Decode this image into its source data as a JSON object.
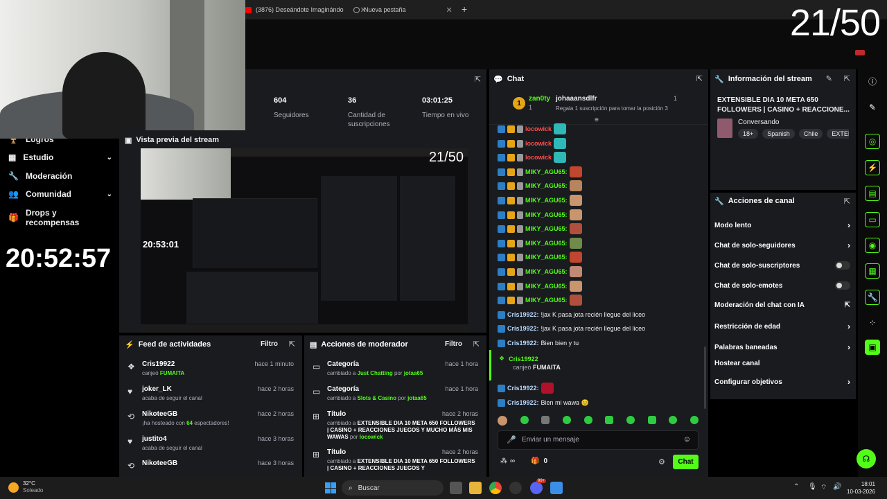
{
  "browser": {
    "tabs": [
      {
        "title": "(3876) Deseándote Imaginándo"
      },
      {
        "title": "Nueva pestaña"
      }
    ],
    "new_tab": "+"
  },
  "overlay": {
    "counter": "21/50"
  },
  "left_nav": {
    "items": [
      {
        "label": "Logros",
        "icon": "trophy-icon"
      },
      {
        "label": "Estudio",
        "icon": "grid-icon",
        "expandable": true
      },
      {
        "label": "Moderación",
        "icon": "wrench-icon"
      },
      {
        "label": "Comunidad",
        "icon": "people-icon",
        "expandable": true
      },
      {
        "label": "Drops y recompensas",
        "icon": "gift-icon"
      }
    ],
    "clock": "20:52:57"
  },
  "stats": [
    {
      "value": "604",
      "label": "Seguidores"
    },
    {
      "value": "36",
      "label": "Cantidad de suscripciones"
    },
    {
      "value": "03:01:25",
      "label": "Tiempo en vivo"
    }
  ],
  "preview": {
    "title": "Vista previa del stream",
    "nested_counter": "21/50",
    "nested_clock": "20:53:01"
  },
  "activity_feed": {
    "title": "Feed de actividades",
    "filter_label": "Filtro",
    "items": [
      {
        "icon": "gift-icon",
        "name": "Cris19922",
        "time": "hace 1 minuto",
        "desc": "canjeó",
        "highlight": "FUMAITA"
      },
      {
        "icon": "heart-icon",
        "name": "joker_LK",
        "time": "hace 2 horas",
        "desc": "acaba de seguir el canal"
      },
      {
        "icon": "host-icon",
        "name": "NikoteeGB",
        "time": "hace 2 horas",
        "desc": "¡ha hosteado con",
        "count": "64",
        "desc2": "espectadores!"
      },
      {
        "icon": "heart-icon",
        "name": "justito4",
        "time": "hace 3 horas",
        "desc": "acaba de seguir el canal"
      },
      {
        "icon": "host-icon",
        "name": "NikoteeGB",
        "time": "hace 3 horas",
        "desc": ""
      }
    ]
  },
  "mod_actions": {
    "title": "Acciones de moderador",
    "filter_label": "Filtro",
    "items": [
      {
        "title": "Categoría",
        "time": "hace 1 hora",
        "prefix": "cambiado a",
        "value": "Just Chatting",
        "by": "por",
        "user": "jotaa65"
      },
      {
        "title": "Categoría",
        "time": "hace 1 hora",
        "prefix": "cambiado a",
        "value": "Slots & Casino",
        "by": "por",
        "user": "jotaa65"
      },
      {
        "title": "Título",
        "time": "hace 2 horas",
        "prefix": "cambiado a",
        "value": "EXTENSIBLE DIA 10 META 650 FOLLOWERS | CASINO + REACCIONES JUEGOS Y MUCHO MÁS MIS WAWAS",
        "by": "por",
        "user": "locowick"
      },
      {
        "title": "Título",
        "time": "hace 2 horas",
        "prefix": "cambiado a",
        "value": "EXTENSIBLE DIA 10 META 650 FOLLOWERS | CASINO + REACCIONES JUEGOS Y",
        "by": "",
        "user": ""
      }
    ]
  },
  "chat": {
    "title": "Chat",
    "leaderboard": [
      {
        "rank": "1",
        "name": "zan0ty",
        "sub": "1"
      },
      {
        "name": "johaaansdlfr",
        "sub": "1",
        "note": "Regala 1 suscripción para tomar la posición 3"
      }
    ],
    "messages": [
      {
        "user": "locowick",
        "color": "#ff4d4d",
        "text": "",
        "emote": "#2fb8b8"
      },
      {
        "user": "locowick",
        "color": "#ff4d4d",
        "text": "",
        "emote": "#2fb8b8"
      },
      {
        "user": "locowick",
        "color": "#ff4d4d",
        "text": "",
        "emote": "#2fb8b8"
      },
      {
        "user": "MIKY_AGU65:",
        "color": "#53fc18",
        "text": "",
        "emote": "#c0462f"
      },
      {
        "user": "MIKY_AGU65:",
        "color": "#53fc18",
        "text": "",
        "emote": "#b8845d"
      },
      {
        "user": "MIKY_AGU65:",
        "color": "#53fc18",
        "text": "",
        "emote": "#c9956d"
      },
      {
        "user": "MIKY_AGU65:",
        "color": "#53fc18",
        "text": "",
        "emote": "#c9956d"
      },
      {
        "user": "MIKY_AGU65:",
        "color": "#53fc18",
        "text": "",
        "emote": "#b0503c"
      },
      {
        "user": "MIKY_AGU65:",
        "color": "#53fc18",
        "text": "",
        "emote": "#6f8a4a"
      },
      {
        "user": "MIKY_AGU65:",
        "color": "#53fc18",
        "text": "",
        "emote": "#c0462f"
      },
      {
        "user": "MIKY_AGU65:",
        "color": "#53fc18",
        "text": "",
        "emote": "#c08a74"
      },
      {
        "user": "MIKY_AGU65:",
        "color": "#53fc18",
        "text": "",
        "emote": "#c9956d"
      },
      {
        "user": "MIKY_AGU65:",
        "color": "#53fc18",
        "text": "",
        "emote": "#b0503c"
      },
      {
        "user": "Cris19922:",
        "color": "#b9d8ff",
        "text": "!jax K pasa jota recién llegue del liceo"
      },
      {
        "user": "Cris19922:",
        "color": "#b9d8ff",
        "text": "!jax K pasa jota recién llegue del liceo"
      },
      {
        "user": "Cris19922:",
        "color": "#b9d8ff",
        "text": "Bien bien y tu"
      }
    ],
    "redeem": {
      "user": "Cris19922",
      "text": "canjeó",
      "reward": "FUMAITA"
    },
    "after": [
      {
        "user": "Cris19922:",
        "text": "",
        "emote": "#b0122c"
      },
      {
        "user": "Cris19922:",
        "text": "Bien mi wawa 😊"
      }
    ],
    "input_placeholder": "Enviar un mensaje",
    "points": "∞",
    "gifts": "0",
    "send_label": "Chat"
  },
  "stream_info": {
    "title": "Información del stream",
    "stream_title": "EXTENSIBLE DIA 10 META 650 FOLLOWERS | CASINO + REACCIONE...",
    "category": "Conversando",
    "tags": [
      "18+",
      "Spanish",
      "Chile",
      "EXTENS"
    ]
  },
  "channel_actions": {
    "title": "Acciones de canal",
    "items": [
      {
        "label": "Modo lento",
        "kind": "chevron"
      },
      {
        "label": "Chat de solo-seguidores",
        "kind": "chevron"
      },
      {
        "label": "Chat de solo-suscriptores",
        "kind": "toggle"
      },
      {
        "label": "Chat de solo-emotes",
        "kind": "toggle"
      },
      {
        "label": "Moderación del chat con IA",
        "kind": "external"
      },
      {
        "label": "Restricción de edad",
        "kind": "chevron"
      },
      {
        "label": "Palabras baneadas",
        "kind": "chevron"
      },
      {
        "label": "Hostear canal",
        "kind": "none"
      },
      {
        "label": "Configurar objetivos",
        "kind": "chevron"
      }
    ]
  },
  "taskbar": {
    "weather_temp": "32°C",
    "weather_desc": "Soleado",
    "search_placeholder": "Buscar",
    "time": "18:01",
    "date": "10-03-2026",
    "badge": "99+"
  },
  "colors": {
    "accent": "#53fc18",
    "panel": "#191b1f",
    "bg": "#000000"
  }
}
